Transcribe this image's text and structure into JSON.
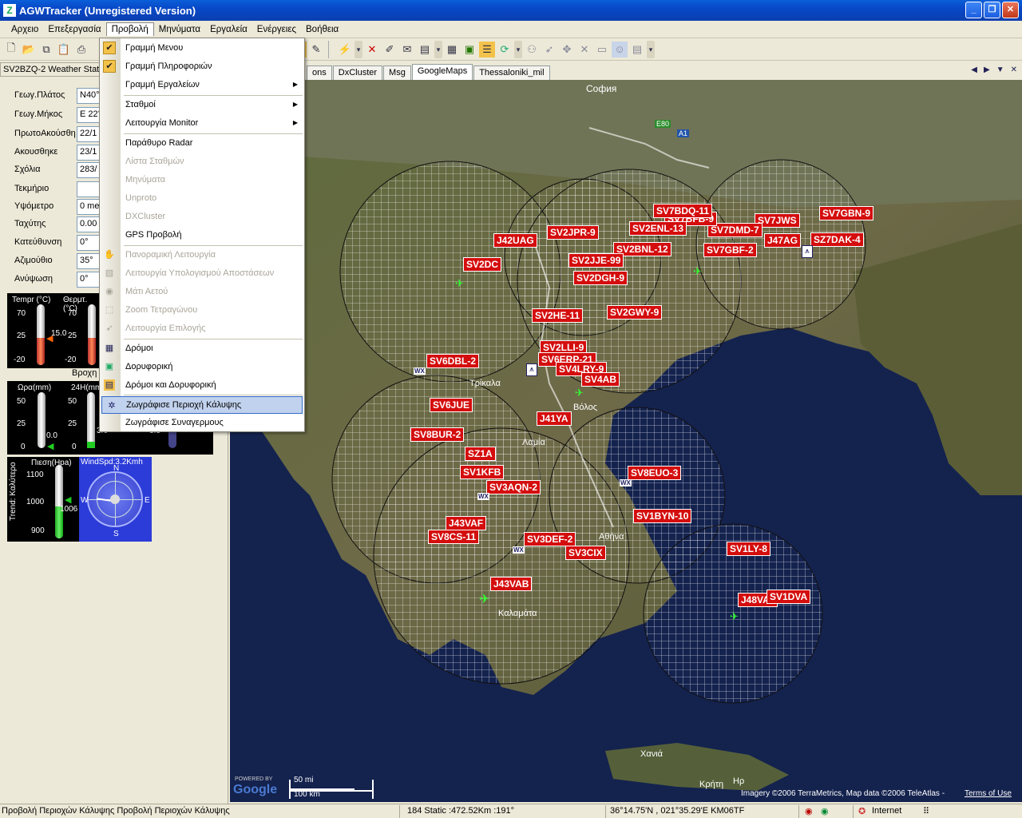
{
  "window": {
    "title": "AGWTracker (Unregistered Version)",
    "controls": [
      "_",
      "❐",
      "✕"
    ]
  },
  "menubar": [
    "Αρχειο",
    "Επεξεργασία",
    "Προβολή",
    "Μηνύματα",
    "Εργαλεία",
    "Ενέργειες",
    "Βοήθεια"
  ],
  "left_title": "SV2BZQ-2 Weather Station",
  "station_fields": [
    {
      "label": "Γεωγ.Πλάτος",
      "value": "N40°"
    },
    {
      "label": "Γεωγ.Μήκος",
      "value": "E 22°"
    },
    {
      "label": "ΠρωτοΑκούσθη",
      "value": "22/1"
    },
    {
      "label": "Ακουσθηκε",
      "value": "23/1"
    },
    {
      "label": "Σχόλια",
      "value": "283/"
    },
    {
      "label": "Τεκμήριο",
      "value": ""
    },
    {
      "label": "Υψόμετρο",
      "value": "0 me"
    },
    {
      "label": "Ταχύτης",
      "value": "0.00"
    },
    {
      "label": "Κατεύθυνση",
      "value": "0°"
    },
    {
      "label": "Αζιμούθιο",
      "value": "35°"
    },
    {
      "label": "Ανύψωση",
      "value": "0°"
    }
  ],
  "gauges": {
    "temp_label": "Tempr (°C)",
    "therm_label": "Θερμτ.(°C)",
    "temp_value": "15.0",
    "ticks_temp": [
      "70",
      "25",
      "-20"
    ],
    "ticks_therm": [
      "70",
      "25",
      "-20"
    ],
    "rain_title": "Βροχη",
    "rain_hour_label": "Ωρα(mm)",
    "rain_24_label": "24H(mm)",
    "rain_ticks": [
      "50",
      "25",
      "0"
    ],
    "rain_hour": "0.0",
    "rain_24": "3.6",
    "rain_other": "3.3",
    "pressure_label": "Πιεση(Hpa)",
    "pressure_ticks": [
      "1100",
      "1000",
      "900"
    ],
    "pressure_value": "1006",
    "trend_label": "Trend: Καλύτερο",
    "wind_label": "WindSpd:3.2Kmh",
    "compass": [
      "N",
      "E",
      "S",
      "W"
    ]
  },
  "tabs": [
    "ons",
    "DxCluster",
    "Msg",
    "GoogleMaps",
    "Thessaloniki_mil"
  ],
  "tab_selected": "GoogleMaps",
  "dropdown": [
    {
      "label": "Γραμμή Μενου",
      "checked": true,
      "y": 0
    },
    {
      "label": "Γραμμή Πληροφοριών",
      "checked": true,
      "y": 1
    },
    {
      "label": "Γραμμή Εργαλείων",
      "submenu": true,
      "y": 2
    },
    {
      "label": "Σταθμοί",
      "submenu": true
    },
    {
      "label": "Λειτουργία Monitor",
      "submenu": true
    },
    {
      "label": "Παράθυρο Radar"
    },
    {
      "label": "Λίστα Σταθμών",
      "disabled": true
    },
    {
      "label": "Μηνύματα",
      "disabled": true
    },
    {
      "label": "Unproto",
      "disabled": true
    },
    {
      "label": "DXCluster",
      "disabled": true
    },
    {
      "label": "GPS Προβολή"
    },
    {
      "label": "Πανοραμική Λειτουργία",
      "disabled": true
    },
    {
      "label": "Λειτουργία Υπολογισμού Αποστάσεων",
      "disabled": true
    },
    {
      "label": "Μάτι Αετού",
      "disabled": true
    },
    {
      "label": "Zoom Τετραγώνου",
      "disabled": true
    },
    {
      "label": "Λειτουργία Επιλογής",
      "disabled": true
    },
    {
      "label": "Δρόμοι",
      "icon": "grid-icon"
    },
    {
      "label": "Δορυφορική",
      "icon": "satellite-icon"
    },
    {
      "label": "Δρόμοι και Δορυφορική",
      "icon": "hybrid-icon"
    },
    {
      "label": "Ζωγράφισε Περιοχή Κάλυψης",
      "icon": "coverage-icon",
      "highlighted": true
    },
    {
      "label": "Ζωγράφισε Συναγερμους"
    }
  ],
  "map": {
    "cities": [
      "София",
      "E80",
      "A1",
      "Βόλος",
      "Λαμία",
      "Τρίκαλα",
      "Αθήνα",
      "Καλαμάτα",
      "Χανιά",
      "Κρήτη",
      "Ηρ"
    ],
    "stations": [
      "SV2BZQ-2",
      "SV7GBN-9",
      "SV7JWS",
      "SZ7DAK-4",
      "J47AG",
      "SV7DMD-7",
      "SV7BFB-9",
      "SV7BDQ-11",
      "J42UAG",
      "SV2JPR-9",
      "SV2ENL-13",
      "SV2BNL-12",
      "SV7GBF-2",
      "SV2DC",
      "SV2JJE-99",
      "SV2DGH-9",
      "SV2GWY-9",
      "SV2HE-11",
      "SV6DBL-2",
      "SV2LLI-9",
      "SV6ERP-21",
      "SV4LRY-9",
      "SV4AB",
      "SV6JUE",
      "J41YA",
      "SV8BUR-2",
      "SZ1A",
      "SV1KFB",
      "SV3AQN-2",
      "SV8EUO-3",
      "SV1BYN-10",
      "J43VAF",
      "SV8CS-11",
      "SV3DEF-2",
      "SV3CIX",
      "SV1LY-8",
      "J43VAB",
      "J48VAJ",
      "SV1DVA"
    ],
    "scale_mi": "50 mi",
    "scale_km": "100 km",
    "powered": "POWERED BY",
    "google": "Google",
    "attribution": "Imagery ©2006 TerraMetrics, Map data ©2006 TeleAtlas -",
    "terms": "Terms of Use"
  },
  "status": {
    "left": "Προβολή Περιοχών Κάλυψης Προβολή Περιοχών Κάλυψης",
    "mid": "184 Static :472.52Km :191°",
    "coords": "36°14.75'N , 021°35.29'E  KM06TF",
    "zone": "Internet"
  }
}
